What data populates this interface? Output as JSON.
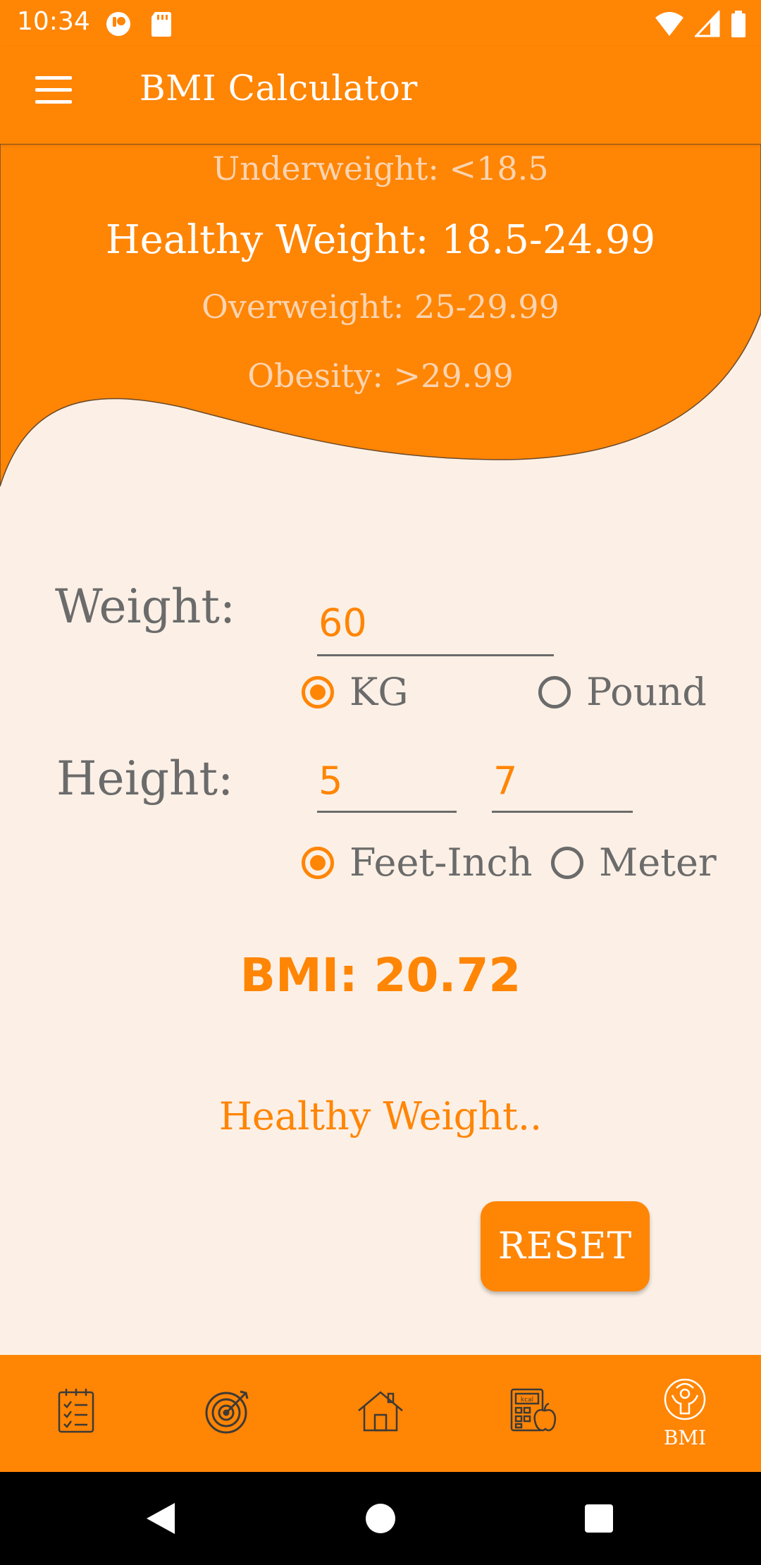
{
  "status_bar": {
    "time": "10:34",
    "icons": [
      "notification-app-icon",
      "sd-card-icon",
      "wifi-icon",
      "signal-icon",
      "battery-icon"
    ]
  },
  "app_bar": {
    "title": "BMI Calculator",
    "menu_icon": "hamburger-menu-icon"
  },
  "bmi_ranges": {
    "underweight": "Underweight: <18.5",
    "healthy": "Healthy Weight: 18.5-24.99",
    "overweight": "Overweight: 25-29.99",
    "obesity": "Obesity: >29.99"
  },
  "form": {
    "weight_label": "Weight:",
    "weight_value": "60",
    "weight_units": {
      "kg": "KG",
      "pound": "Pound",
      "selected": "KG"
    },
    "height_label": "Height:",
    "height_feet_value": "5",
    "height_inch_value": "7",
    "height_units": {
      "feet_inch": "Feet-Inch",
      "meter": "Meter",
      "selected": "Feet-Inch"
    }
  },
  "result": {
    "bmi_text": "BMI: 20.72",
    "status_text": "Healthy Weight.."
  },
  "reset_label": "RESET",
  "bottom_nav": {
    "items": [
      {
        "icon": "checklist-icon",
        "label": ""
      },
      {
        "icon": "target-icon",
        "label": ""
      },
      {
        "icon": "home-icon",
        "label": ""
      },
      {
        "icon": "calorie-calculator-icon",
        "label": ""
      },
      {
        "icon": "bmi-person-icon",
        "label": "BMI"
      }
    ],
    "active_index": 4
  },
  "colors": {
    "accent": "#ff8505",
    "background": "#fcf0e6",
    "text_gray": "#6b6b6b",
    "nav_icon_dark": "#3d3a36"
  }
}
